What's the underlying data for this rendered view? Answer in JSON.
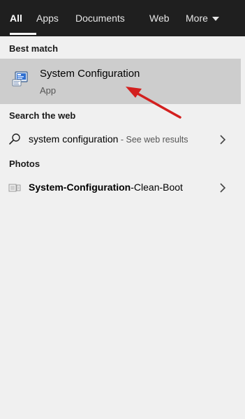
{
  "tabs": {
    "all": "All",
    "apps": "Apps",
    "documents": "Documents",
    "web": "Web",
    "more": "More"
  },
  "sections": {
    "best_match": "Best match",
    "search_web": "Search the web",
    "photos": "Photos"
  },
  "best_match": {
    "name": "System Configuration",
    "kind": "App",
    "icon": "system-configuration-icon"
  },
  "web_result": {
    "query": "system configuration",
    "suffix": " - See web results",
    "icon": "search-icon"
  },
  "photo_result": {
    "part1": "System-Configuration",
    "part2": "-Clean-Boot",
    "icon": "photo-icon"
  },
  "colors": {
    "tabbar_bg": "#1f1f1f",
    "panel_bg": "#f0f0f0",
    "selected_bg": "#cdcdcd",
    "arrow": "#d3201f"
  }
}
